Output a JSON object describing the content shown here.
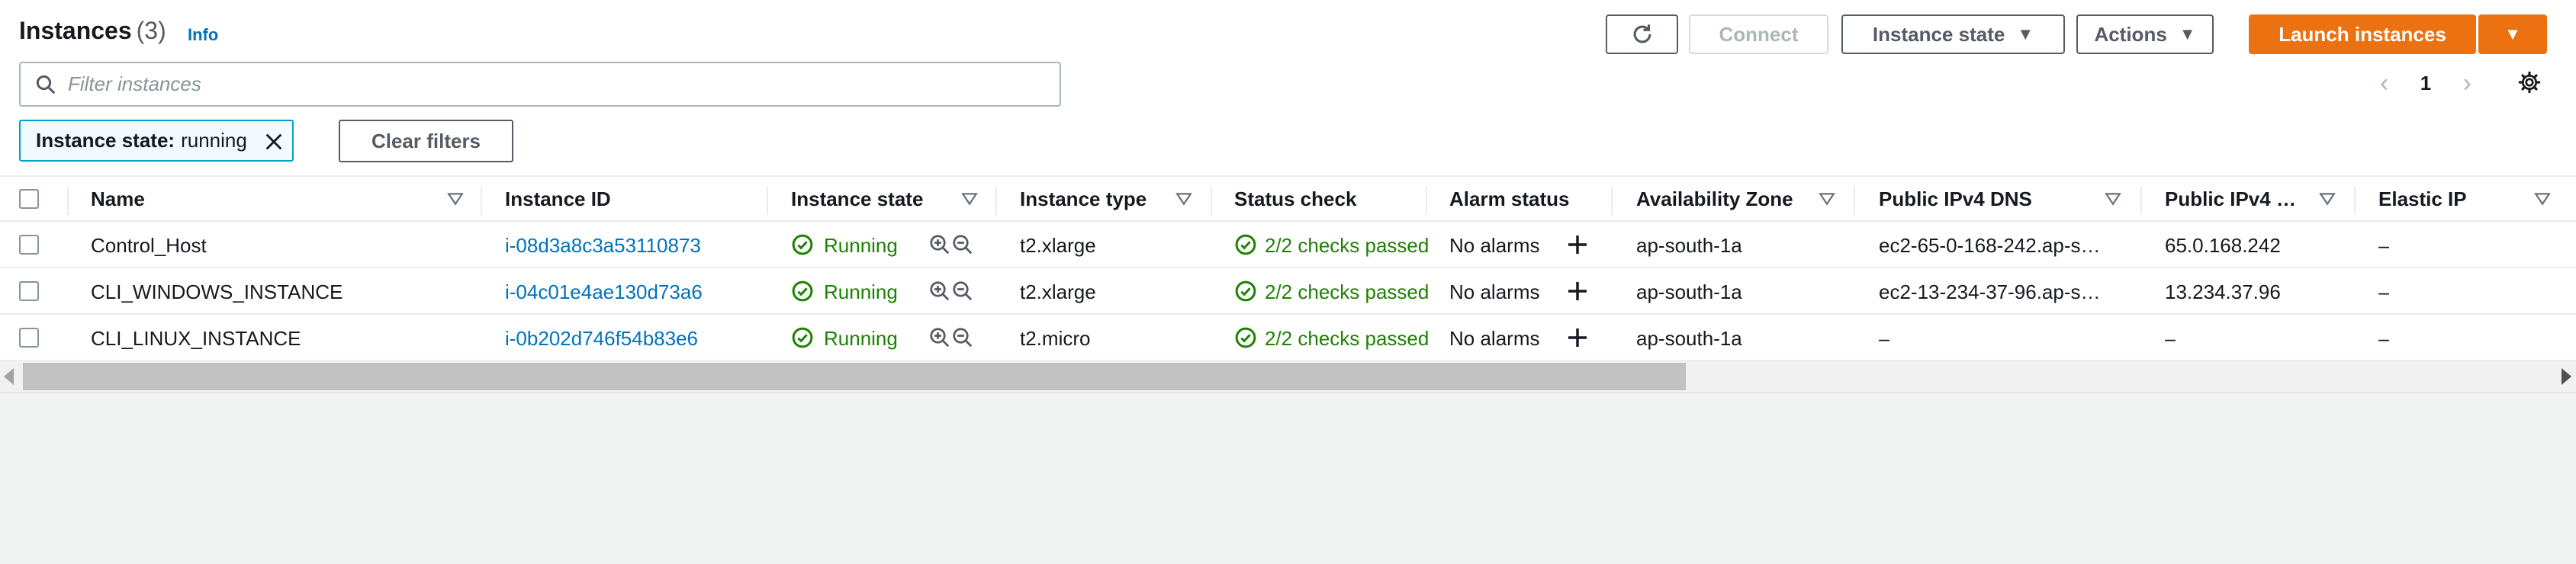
{
  "header": {
    "title": "Instances",
    "count": "(3)",
    "info": "Info"
  },
  "toolbar": {
    "connect": "Connect",
    "instance_state": "Instance state",
    "actions": "Actions",
    "launch": "Launch instances"
  },
  "search": {
    "placeholder": "Filter instances",
    "value": ""
  },
  "pagination": {
    "current_page": "1"
  },
  "filter_token": {
    "key": "Instance state:",
    "value": "running"
  },
  "clear_filters": "Clear filters",
  "table": {
    "columns": {
      "name": "Name",
      "instance_id": "Instance ID",
      "instance_state": "Instance state",
      "instance_type": "Instance type",
      "status_check": "Status check",
      "alarm_status": "Alarm status",
      "availability_zone": "Availability Zone",
      "public_dns": "Public IPv4 DNS",
      "public_ip": "Public IPv4 …",
      "elastic_ip": "Elastic IP"
    },
    "rows": [
      {
        "name": "Control_Host",
        "instance_id": "i-08d3a8c3a53110873",
        "state": "Running",
        "type": "t2.xlarge",
        "status_check": "2/2 checks passed",
        "alarm": "No alarms",
        "az": "ap-south-1a",
        "dns": "ec2-65-0-168-242.ap-s…",
        "ip": "65.0.168.242",
        "elastic": "–"
      },
      {
        "name": "CLI_WINDOWS_INSTANCE",
        "instance_id": "i-04c01e4ae130d73a6",
        "state": "Running",
        "type": "t2.xlarge",
        "status_check": "2/2 checks passed",
        "alarm": "No alarms",
        "az": "ap-south-1a",
        "dns": "ec2-13-234-37-96.ap-s…",
        "ip": "13.234.37.96",
        "elastic": "–"
      },
      {
        "name": "CLI_LINUX_INSTANCE",
        "instance_id": "i-0b202d746f54b83e6",
        "state": "Running",
        "type": "t2.micro",
        "status_check": "2/2 checks passed",
        "alarm": "No alarms",
        "az": "ap-south-1a",
        "dns": "–",
        "ip": "–",
        "elastic": "–"
      }
    ]
  },
  "colors": {
    "primary_button": "#ec7211",
    "link": "#0073bb",
    "success": "#1d8102",
    "filter_token_border": "#00a1c9"
  },
  "icons": [
    "refresh-icon",
    "caret-down-icon",
    "search-icon",
    "chevron-left-icon",
    "chevron-right-icon",
    "gear-icon",
    "close-icon",
    "sort-icon",
    "check-circle-icon",
    "zoom-in-icon",
    "zoom-out-icon",
    "plus-icon"
  ]
}
